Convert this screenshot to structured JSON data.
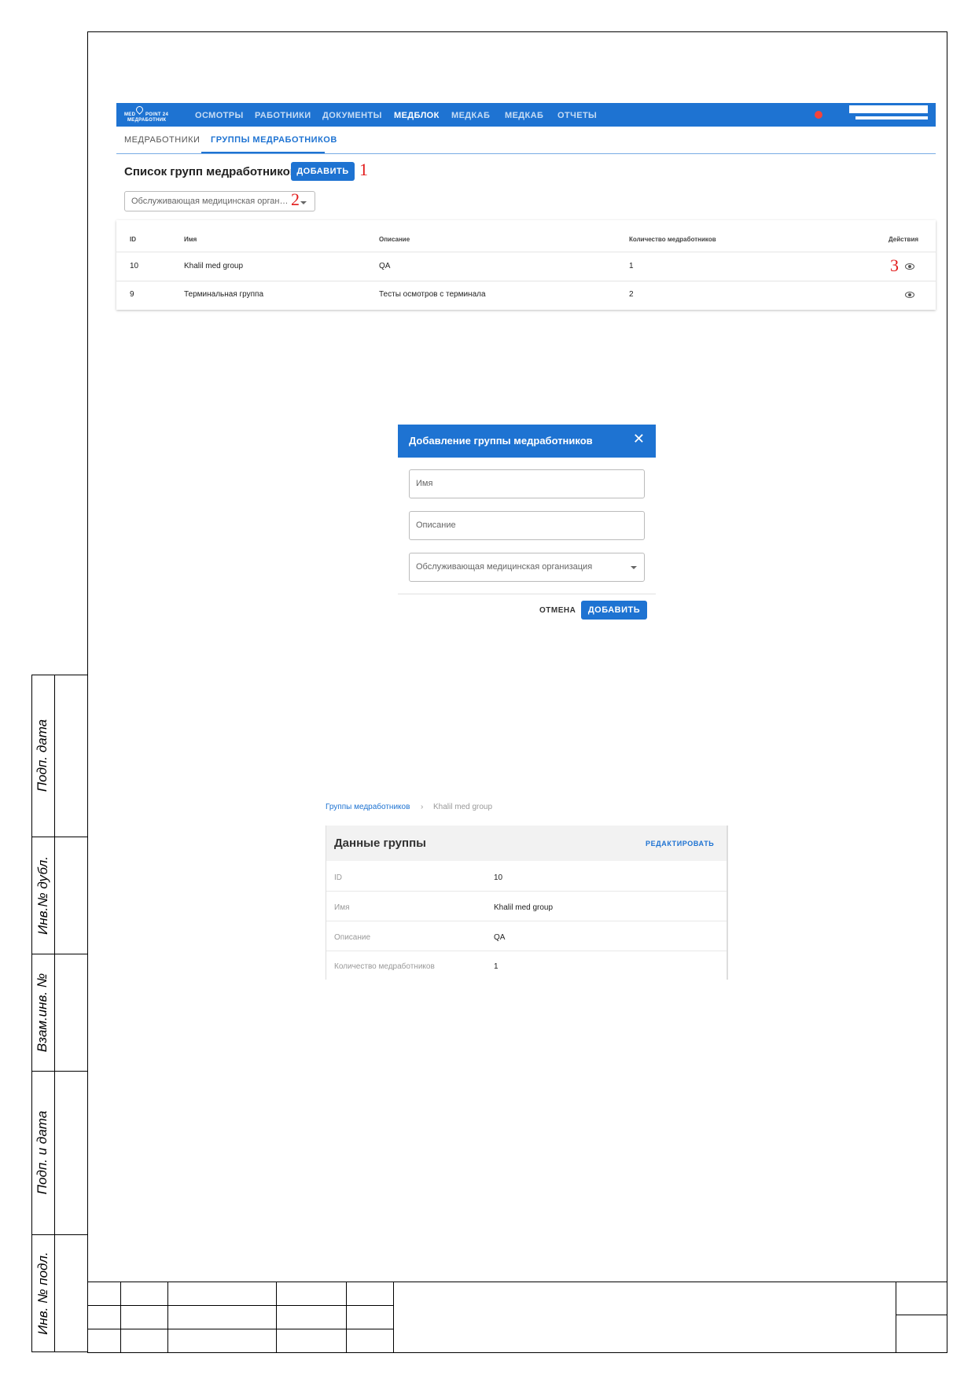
{
  "nav": {
    "logo": {
      "line1": "MED",
      "line2": "POINT 24",
      "line3": "МЕДРАБОТНИК"
    },
    "items": [
      "ОСМОТРЫ",
      "РАБОТНИКИ",
      "ДОКУМЕНТЫ",
      "МЕДБЛОК",
      "МЕДКАБ",
      "МЕДКАБ",
      "ОТЧЕТЫ"
    ],
    "active": "МЕДБЛОК",
    "status_color": "#f4433a",
    "accent_color": "#1e73d2"
  },
  "subtabs": [
    "МЕДРАБОТНИКИ",
    "ГРУППЫ МЕДРАБОТНИКОВ"
  ],
  "list": {
    "title": "Список групп медработников",
    "add_button": "ДОБАВИТЬ",
    "filter_value": "Обслуживающая медицинская орган…",
    "columns": [
      "ID",
      "Имя",
      "Описание",
      "Количество медработников",
      "Действия"
    ],
    "rows": [
      {
        "id": "10",
        "name": "Khalil med group",
        "description": "QA",
        "count": "1"
      },
      {
        "id": "9",
        "name": "Терминальная группа",
        "description": "Тесты осмотров с терминала",
        "count": "2"
      }
    ]
  },
  "callouts": [
    "1",
    "2",
    "3"
  ],
  "dialog": {
    "title": "Добавление группы медработников",
    "close": "✕",
    "name_placeholder": "Имя",
    "description_placeholder": "Описание",
    "org_placeholder": "Обслуживающая медицинская организация",
    "cancel_button": "ОТМЕНА",
    "submit_button": "ДОБАВИТЬ"
  },
  "details": {
    "breadcrumb": [
      "Группы медработников",
      "›",
      "Khalil med group"
    ],
    "title": "Данные группы",
    "edit_button": "РЕДАКТИРОВАТЬ",
    "fields": [
      {
        "label": "ID",
        "value": "10"
      },
      {
        "label": "Имя",
        "value": "Khalil med group"
      },
      {
        "label": "Описание",
        "value": "QA"
      },
      {
        "label": "Количество медработников",
        "value": "1"
      }
    ]
  },
  "side_labels": [
    "Подп. дата",
    "Инв.№ дубл.",
    "Взам.инв. №",
    "Подп. и дата",
    "Инв. № подл."
  ]
}
